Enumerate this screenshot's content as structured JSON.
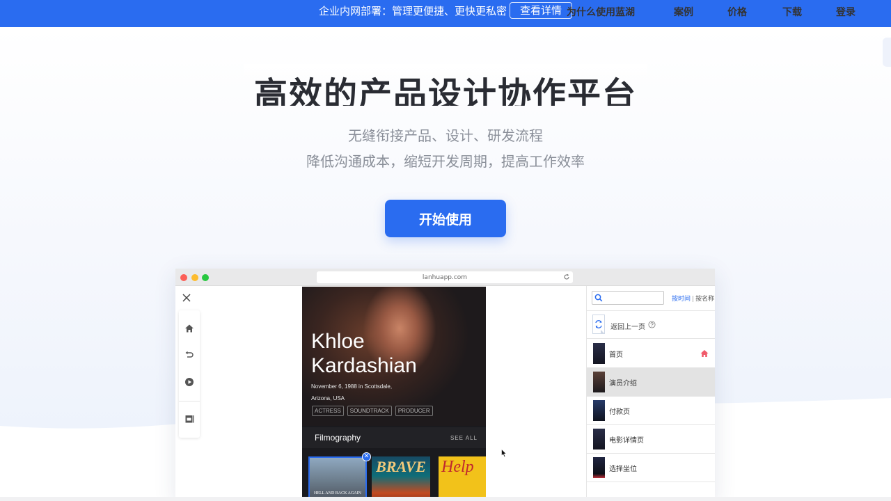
{
  "banner": {
    "text": "企业内网部署：管理更便捷、更快更私密",
    "button_label": "查看详情"
  },
  "nav": {
    "items": [
      {
        "label": "为什么使用蓝湖"
      },
      {
        "label": "案例"
      },
      {
        "label": "价格"
      },
      {
        "label": "下载"
      },
      {
        "label": "登录"
      }
    ]
  },
  "hero": {
    "title": "高效的产品设计协作平台",
    "subtitle_line1": "无缝衔接产品、设计、研发流程",
    "subtitle_line2": "降低沟通成本，缩短开发周期，提高工作效率",
    "cta_label": "开始使用"
  },
  "mockup": {
    "url": "lanhuapp.com",
    "phone": {
      "name": "Khloe\nKardashian",
      "info": "November 6, 1988 in Scottsdale,\nArizona, USA",
      "tags": [
        "ACTRESS",
        "SOUNDTRACK",
        "PRODUCER"
      ],
      "section_title": "Filmography",
      "see_all": "SEE ALL",
      "posters": [
        {
          "title": "HELL AND BACK AGAIN"
        },
        {
          "title": "BRAVE"
        },
        {
          "title": "Help"
        }
      ]
    },
    "sidebar": {
      "sort_by_time": "按时间",
      "sort_by_name": "按名称",
      "back_label": "返回上一页",
      "pages": [
        {
          "label": "首页",
          "is_home": true
        },
        {
          "label": "演员介绍",
          "selected": true
        },
        {
          "label": "付款页"
        },
        {
          "label": "电影详情页"
        },
        {
          "label": "选择坐位"
        }
      ]
    }
  },
  "colors": {
    "brand_blue": "#2a6cf0",
    "title_dark": "#2a2c33",
    "subtitle_gray": "#8a8f99"
  }
}
